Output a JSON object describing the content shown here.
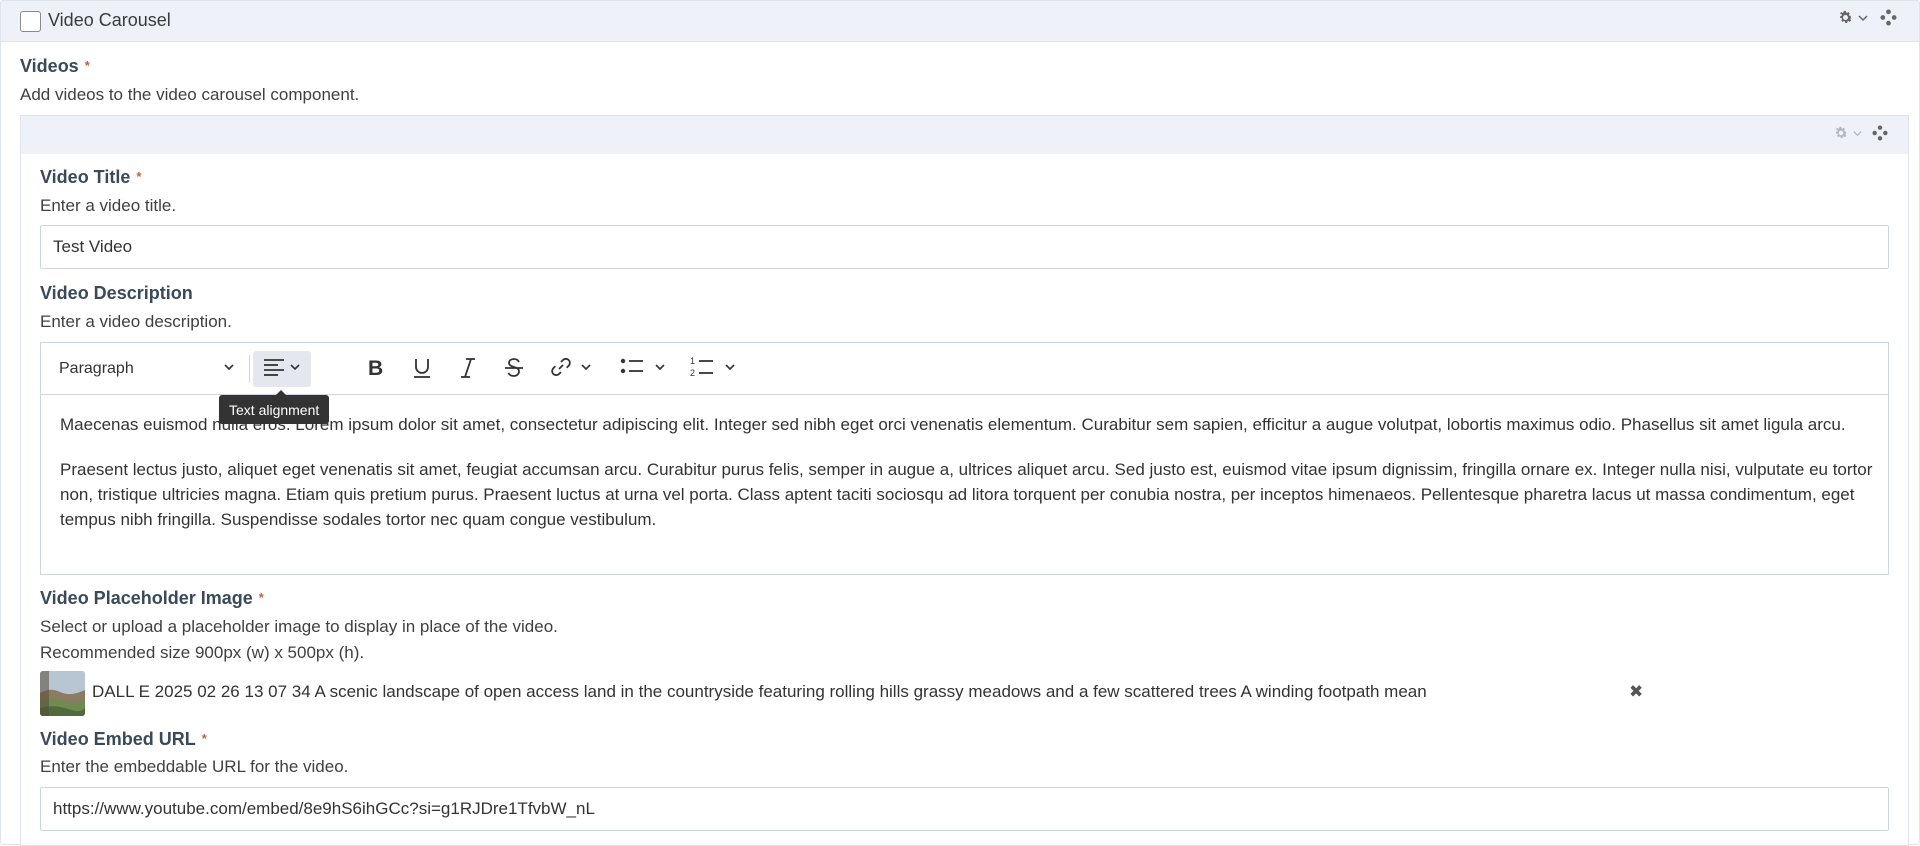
{
  "panel": {
    "title": "Video Carousel",
    "icons": [
      "gear-icon",
      "chevron-down-icon",
      "move-icon"
    ]
  },
  "videos": {
    "label": "Videos",
    "required_mark": "*",
    "help": "Add videos to the video carousel component."
  },
  "item": {
    "icons": [
      "gear-icon",
      "chevron-down-icon",
      "move-icon"
    ],
    "title_field": {
      "label": "Video Title",
      "required_mark": "*",
      "help": "Enter a video title.",
      "value": "Test Video"
    },
    "description_field": {
      "label": "Video Description",
      "help": "Enter a video description.",
      "toolbar": {
        "block_format": "Paragraph",
        "buttons": [
          "text-align-icon",
          "bold-icon",
          "underline-icon",
          "italic-icon",
          "strikethrough-icon",
          "link-icon",
          "bulleted-list-icon",
          "numbered-list-icon"
        ],
        "tooltip": "Text alignment"
      },
      "paragraphs": [
        "Maecenas euismod nulla eros. Lorem ipsum dolor sit amet, consectetur adipiscing elit. Integer sed nibh eget orci venenatis elementum. Curabitur sem sapien, efficitur a augue volutpat, lobortis maximus odio. Phasellus sit amet ligula arcu.",
        "Praesent lectus justo, aliquet eget venenatis sit amet, feugiat accumsan arcu. Curabitur purus felis, semper in augue a, ultrices aliquet arcu. Sed justo est, euismod vitae ipsum dignissim, fringilla ornare ex. Integer nulla nisi, vulputate eu tortor non, tristique ultricies magna. Etiam quis pretium purus. Praesent luctus at urna vel porta. Class aptent taciti sociosqu ad litora torquent per conubia nostra, per inceptos himenaeos. Pellentesque pharetra lacus ut massa condimentum, eget tempus nibh fringilla. Suspendisse sodales tortor nec quam congue vestibulum."
      ]
    },
    "image_field": {
      "label": "Video Placeholder Image",
      "required_mark": "*",
      "help_line1": "Select or upload a placeholder image to display in place of the video.",
      "help_line2": "Recommended size 900px (w) x 500px (h).",
      "file_name": "DALL E 2025 02 26 13 07 34 A scenic landscape of open access land in the countryside featuring rolling hills grassy meadows and a few scattered trees A winding footpath mean",
      "remove_label": "✖"
    },
    "embed_field": {
      "label": "Video Embed URL",
      "required_mark": "*",
      "help": "Enter the embeddable URL for the video.",
      "value": "https://www.youtube.com/embed/8e9hS6ihGCc?si=g1RJDre1TfvbW_nL"
    }
  }
}
